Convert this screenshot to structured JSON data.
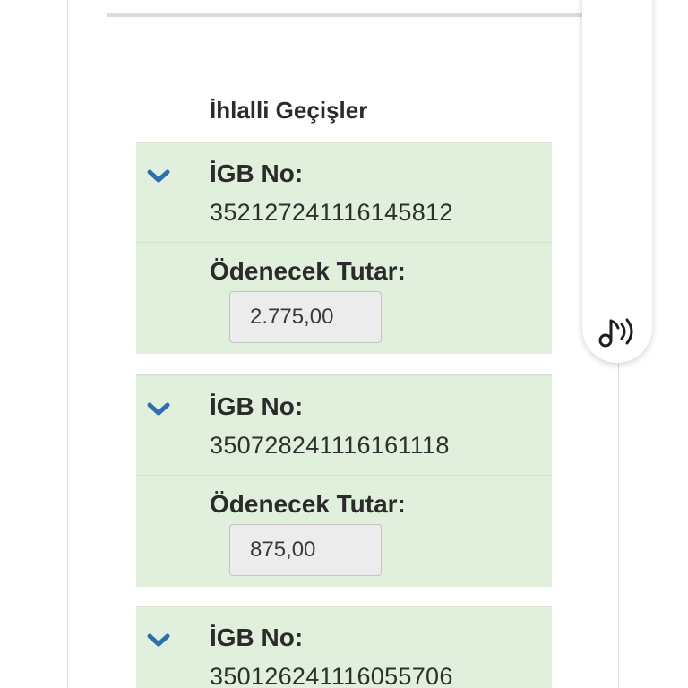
{
  "section": {
    "title": "İhlalli Geçişler"
  },
  "violations": [
    {
      "igb_label": "İGB No:",
      "igb_number": "352127241116145812",
      "amount_label": "Ödenecek Tutar:",
      "amount_value": "2.775,00"
    },
    {
      "igb_label": "İGB No:",
      "igb_number": "350728241116161118",
      "amount_label": "Ödenecek Tutar:",
      "amount_value": "875,00"
    },
    {
      "igb_label": "İGB No:",
      "igb_number": "350126241116055706"
    }
  ],
  "icons": {
    "expand": "chevron-down-icon",
    "audio": "audio-reader-icon"
  },
  "colors": {
    "card_background": "#e1f0dc",
    "chevron": "#2f6fb0",
    "amount_box": "#ececec"
  }
}
